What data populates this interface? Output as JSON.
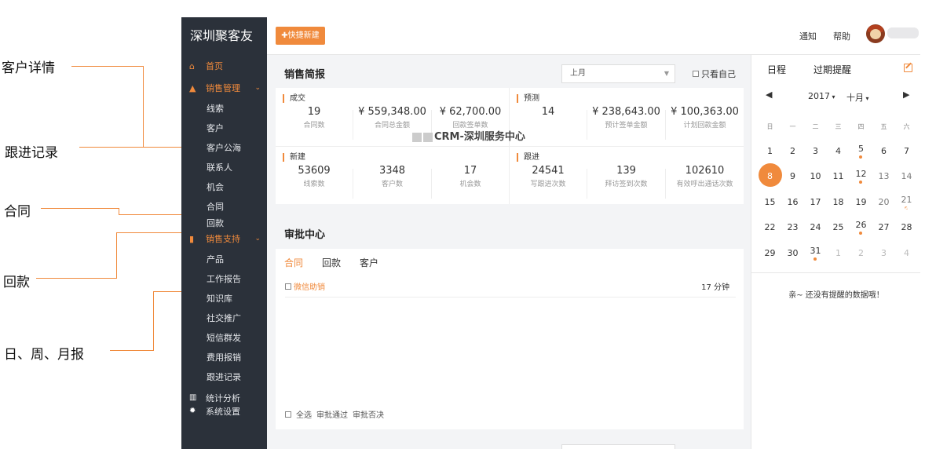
{
  "annotations": [
    "客户详情",
    "跟进记录",
    "合同",
    "回款",
    "日、周、月报"
  ],
  "sidebar": {
    "brand": "深圳聚客友",
    "home": "首页",
    "sales_mgmt": "销售管理",
    "sales_items": [
      "线索",
      "客户",
      "客户公海",
      "联系人",
      "机会",
      "合同",
      "回款"
    ],
    "sales_support": "销售支持",
    "support_items": [
      "产品",
      "工作报告",
      "知识库",
      "社交推广",
      "短信群发",
      "费用报销",
      "跟进记录"
    ],
    "stats": "统计分析",
    "settings": "系统设置"
  },
  "topbar": {
    "quick_new": "✚快捷新建",
    "notify": "通知",
    "help": "帮助"
  },
  "sales_brief": {
    "title": "销售简报",
    "period": "上月",
    "only_me": "只看自己",
    "deal": {
      "title": "成交",
      "cells": [
        {
          "value": "19",
          "label": "合同数"
        },
        {
          "value": "¥ 559,348.00",
          "label": "合同总金额"
        },
        {
          "value": "¥ 62,700.00",
          "label": "回款签单数"
        }
      ]
    },
    "forecast": {
      "title": "预测",
      "cells": [
        {
          "value": "14",
          "label": ""
        },
        {
          "value": "¥ 238,643.00",
          "label": "预计签单金额"
        },
        {
          "value": "¥ 100,363.00",
          "label": "计划回款金额"
        }
      ]
    },
    "new": {
      "title": "新建",
      "cells": [
        {
          "value": "53609",
          "label": "线索数"
        },
        {
          "value": "3348",
          "label": "客户数"
        },
        {
          "value": "17",
          "label": "机会数"
        }
      ]
    },
    "follow": {
      "title": "跟进",
      "cells": [
        {
          "value": "24541",
          "label": "写跟进次数"
        },
        {
          "value": "139",
          "label": "拜访签到次数"
        },
        {
          "value": "102610",
          "label": "有效呼出通话次数"
        }
      ]
    },
    "watermark": "CRM-深圳服务中心"
  },
  "approval": {
    "title": "审批中心",
    "tabs": [
      "合同",
      "回款",
      "客户"
    ],
    "item_name": "微信助销",
    "item_time": "17 分钟",
    "select_all": "全选",
    "approve": "审批通过",
    "reject": "审批否决"
  },
  "calendar": {
    "tab_schedule": "日程",
    "tab_expired": "过期提醒",
    "year": "2017",
    "month": "十月",
    "weekdays": [
      "日",
      "一",
      "二",
      "三",
      "四",
      "五",
      "六"
    ],
    "weeks": [
      [
        "1",
        "2",
        "3",
        "4",
        "5",
        "6",
        "7"
      ],
      [
        "8",
        "9",
        "10",
        "11",
        "12",
        "13",
        "14"
      ],
      [
        "15",
        "16",
        "17",
        "18",
        "19",
        "20",
        "21"
      ],
      [
        "22",
        "23",
        "24",
        "25",
        "26",
        "27",
        "28"
      ],
      [
        "29",
        "30",
        "31",
        "1",
        "2",
        "3",
        "4"
      ]
    ],
    "today": "8",
    "no_reminder": "亲~ 还没有提醒的数据哦！"
  },
  "colors": {
    "accent": "#f08a3c",
    "sidebar": "#2b313a"
  }
}
